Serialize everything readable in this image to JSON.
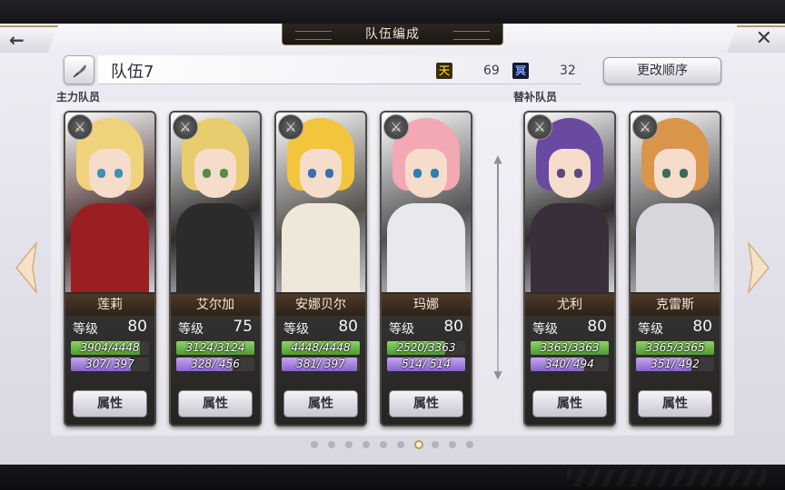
{
  "header": {
    "title": "队伍编成",
    "back_icon": "back-arrow-icon",
    "close_icon": "close-icon"
  },
  "team": {
    "name": "队伍7",
    "heaven_label": "天",
    "heaven_value": "69",
    "hell_label": "冥",
    "hell_value": "32",
    "reorder_label": "更改顺序"
  },
  "sections": {
    "main_label": "主力队员",
    "sub_label": "替补队员"
  },
  "cards": [
    {
      "name": "莲莉",
      "level_label": "等级",
      "level": "80",
      "hp": "3904/4448",
      "mp": "307/ 397",
      "hp_frac": 0.878,
      "mp_frac": 0.773,
      "attr_label": "属性",
      "weapon_icon": "sword-icon",
      "hair_color": "#f0d27a",
      "eye_color": "#3f8fb8",
      "outfit_color": "#9b1f22"
    },
    {
      "name": "艾尔加",
      "level_label": "等级",
      "level": "75",
      "hp": "3124/3124",
      "mp": "328/ 456",
      "hp_frac": 1.0,
      "mp_frac": 0.719,
      "attr_label": "属性",
      "weapon_icon": "sword-icon",
      "hair_color": "#e8cc6e",
      "eye_color": "#5a8a4a",
      "outfit_color": "#2c2a2c"
    },
    {
      "name": "安娜贝尔",
      "level_label": "等级",
      "level": "80",
      "hp": "4448/4448",
      "mp": "381/ 397",
      "hp_frac": 1.0,
      "mp_frac": 0.96,
      "attr_label": "属性",
      "weapon_icon": "sword-icon",
      "hair_color": "#f2c53c",
      "eye_color": "#3a6fb0",
      "outfit_color": "#efe8d8"
    },
    {
      "name": "玛娜",
      "level_label": "等级",
      "level": "80",
      "hp": "2520/3363",
      "mp": "514/ 514",
      "hp_frac": 0.749,
      "mp_frac": 1.0,
      "attr_label": "属性",
      "weapon_icon": "sword-icon",
      "hair_color": "#f3a8b4",
      "eye_color": "#2f7fb4",
      "outfit_color": "#e8e8ee"
    },
    {
      "name": "尤利",
      "level_label": "等级",
      "level": "80",
      "hp": "3363/3363",
      "mp": "340/ 494",
      "hp_frac": 1.0,
      "mp_frac": 0.688,
      "attr_label": "属性",
      "weapon_icon": "sword-icon",
      "hair_color": "#6a4aa0",
      "eye_color": "#5b4a7a",
      "outfit_color": "#3a2e3a"
    },
    {
      "name": "克雷斯",
      "level_label": "等级",
      "level": "80",
      "hp": "3365/3365",
      "mp": "351/ 492",
      "hp_frac": 1.0,
      "mp_frac": 0.713,
      "attr_label": "属性",
      "weapon_icon": "sword-icon",
      "hair_color": "#d9954a",
      "eye_color": "#3b6b55",
      "outfit_color": "#d6d6dc"
    }
  ],
  "pager": {
    "count": 10,
    "active_index": 6
  },
  "colors": {
    "accent_gold": "#c89a3a",
    "hp_green": "#6fbf4d",
    "mp_purple": "#a886dc"
  }
}
